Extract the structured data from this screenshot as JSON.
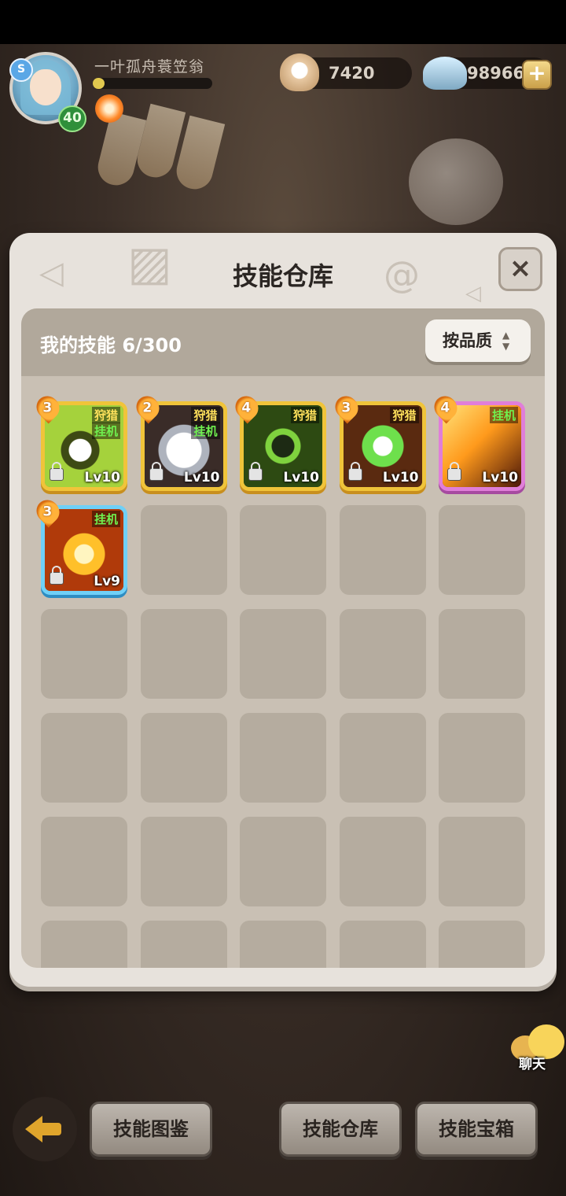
{
  "player": {
    "name": "一叶孤舟蓑笠翁",
    "level": "40",
    "exp_fraction": 0.1
  },
  "currency": {
    "pearl": "7420",
    "shell": "98966"
  },
  "panel": {
    "title": "技能仓库",
    "close_label": "×",
    "count_label": "我的技能 6/300",
    "sort_label": "按品质",
    "sort_arrows": "▲\n▼"
  },
  "skills": [
    {
      "stars": "3",
      "tags": [
        "狩猎",
        "挂机"
      ],
      "level": "Lv10",
      "rarity": "gold",
      "icon": "music-ghost-icon"
    },
    {
      "stars": "2",
      "tags": [
        "狩猎",
        "挂机"
      ],
      "level": "Lv10",
      "rarity": "gold",
      "icon": "owl-icon"
    },
    {
      "stars": "4",
      "tags": [
        "狩猎"
      ],
      "level": "Lv10",
      "rarity": "gold",
      "icon": "robot-icon"
    },
    {
      "stars": "3",
      "tags": [
        "狩猎"
      ],
      "level": "Lv10",
      "rarity": "gold",
      "icon": "heal-cross-icon"
    },
    {
      "stars": "4",
      "tags": [
        "挂机"
      ],
      "level": "Lv10",
      "rarity": "purple",
      "icon": "feather-blade-icon"
    },
    {
      "stars": "3",
      "tags": [
        "挂机"
      ],
      "level": "Lv9",
      "rarity": "blue",
      "icon": "flame-burst-icon"
    }
  ],
  "chat": {
    "label": "聊天"
  },
  "bottom_nav": {
    "codex": "技能图鉴",
    "storage": "技能仓库",
    "chest": "技能宝箱"
  },
  "colors": {
    "gold_frame": "#f0c43a",
    "purple_frame": "#e07ed9",
    "blue_frame": "#6fd0f7",
    "panel_bg": "#e7e2dc"
  }
}
